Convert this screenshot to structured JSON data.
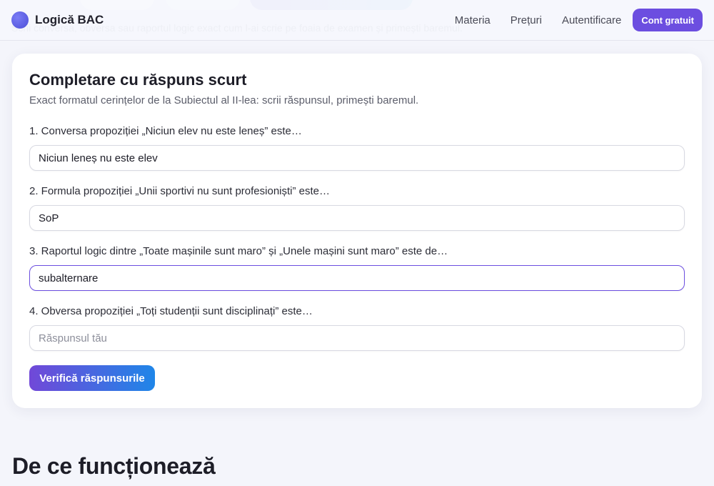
{
  "header": {
    "brand": "Logică BAC",
    "nav": [
      "Materia",
      "Prețuri",
      "Autentificare"
    ],
    "cta": "Cont gratuit"
  },
  "background_text": "Scrii conversa, obversa sau raportul logic exact cum l-ai scrie pe foaia de examen și primești baremul.",
  "card": {
    "title": "Completare cu răspuns scurt",
    "subtitle": "Exact formatul cerințelor de la Subiectul al II-lea: scrii răspunsul, primești baremul.",
    "questions": [
      {
        "label": "1. Conversa propoziției „Niciun elev nu este leneș” este…",
        "value": "Niciun leneș nu este elev",
        "placeholder": "Răspunsul tău"
      },
      {
        "label": "2. Formula propoziției „Unii sportivi nu sunt profesioniști” este…",
        "value": "SoP",
        "placeholder": "Răspunsul tău"
      },
      {
        "label": "3. Raportul logic dintre „Toate mașinile sunt maro” și „Unele mașini sunt maro” este de…",
        "value": "subalternare",
        "placeholder": "Răspunsul tău"
      },
      {
        "label": "4. Obversa propoziției „Toți studenții sunt disciplinați” este…",
        "value": "",
        "placeholder": "Răspunsul tău"
      }
    ],
    "verify_label": "Verifică răspunsurile"
  },
  "section": {
    "title": "De ce funcționează"
  },
  "colors": {
    "accent": "#6c4ee0",
    "gradient_start": "#7148d8",
    "gradient_end": "#1f86e8"
  }
}
